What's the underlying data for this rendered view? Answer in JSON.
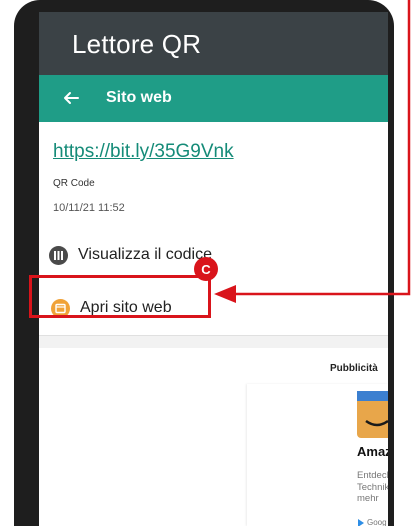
{
  "app": {
    "title": "Lettore QR"
  },
  "toolbar": {
    "title": "Sito web"
  },
  "result": {
    "url": "https://bit.ly/35G9Vnk",
    "type": "QR Code",
    "datetime": "10/11/21 11:52"
  },
  "actions": {
    "view_code": "Visualizza il codice",
    "open_website": "Apri sito web"
  },
  "ad": {
    "label": "Pubblicità",
    "title": "Amaz",
    "body_lines": [
      "Entdeck",
      "Technik",
      "mehr"
    ],
    "store": "Goog"
  },
  "annotation": {
    "badge": "C",
    "color": "#d9141b"
  },
  "colors": {
    "title_bar": "#3b4246",
    "toolbar": "#1f9d87",
    "link": "#158b78"
  },
  "icons": {
    "back": "arrow-left-icon",
    "view": "barcode-icon",
    "open": "browser-icon"
  }
}
